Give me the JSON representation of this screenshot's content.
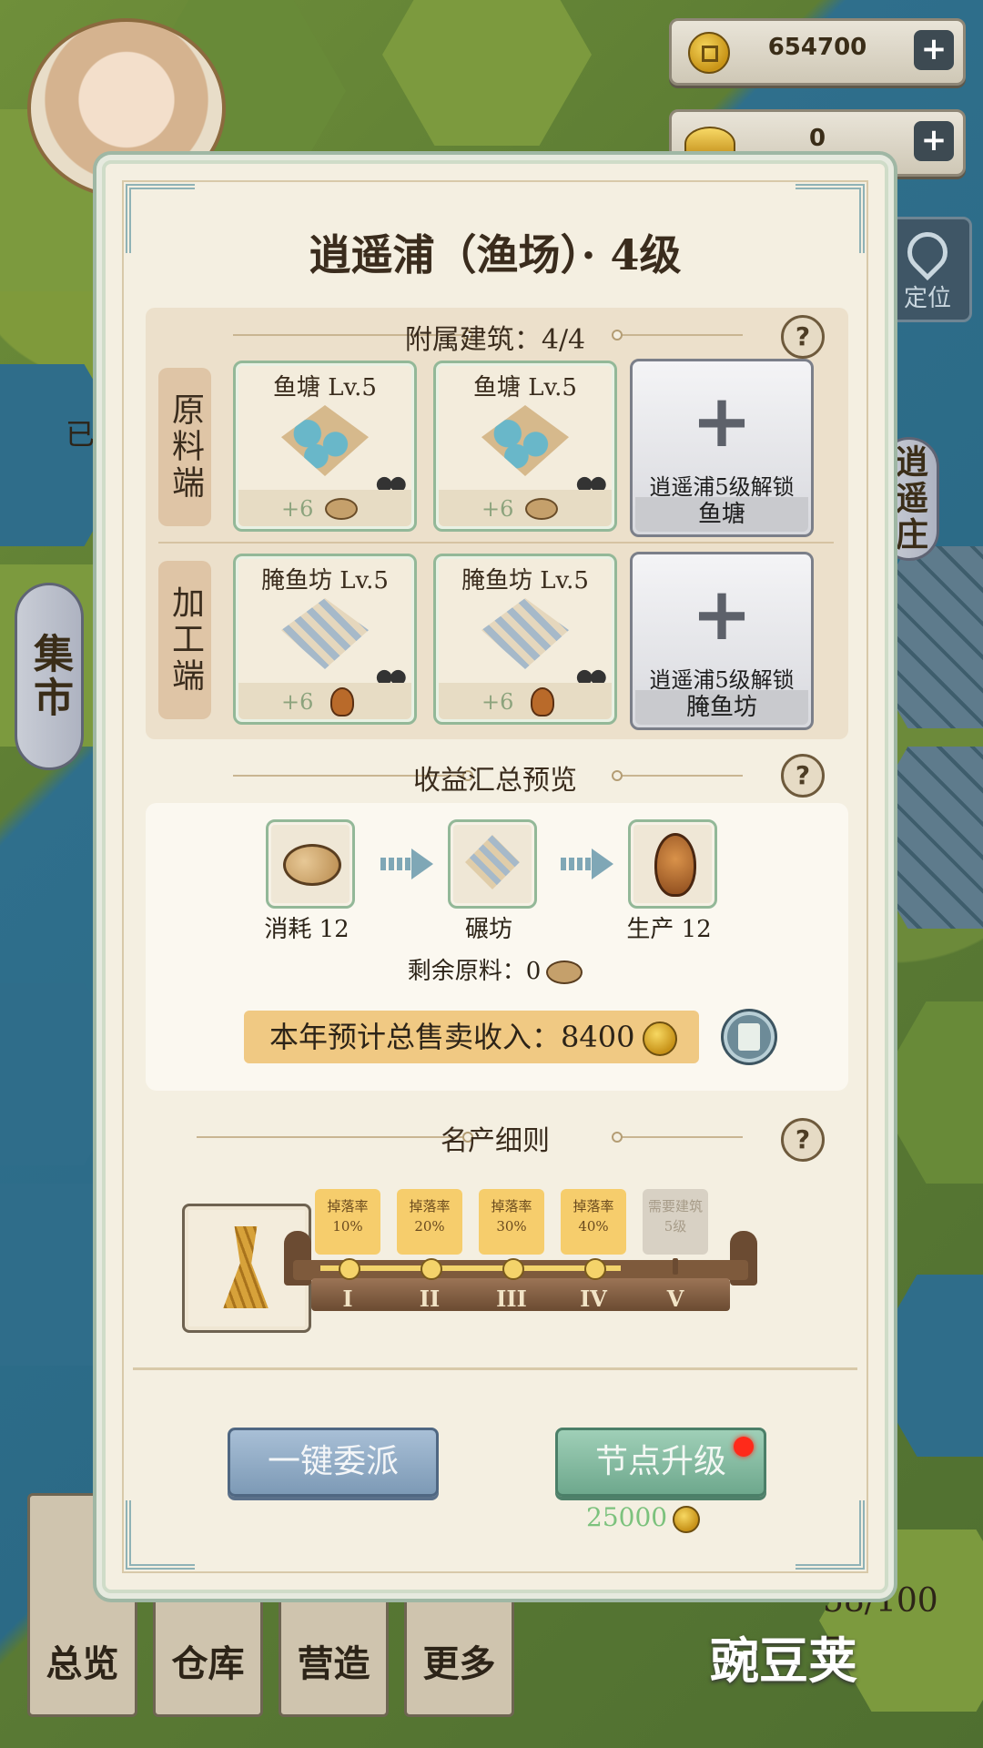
{
  "resources": {
    "copper_coins": "654700",
    "gold_ingots": "0",
    "add_label": "+"
  },
  "locate_label": "定位",
  "side_scrolls": {
    "market": "集市",
    "xiaoyaozhuang": "逍遥庄",
    "partial_left": "已"
  },
  "bottom_nav": [
    "总览",
    "仓库",
    "营造",
    "更多"
  ],
  "bottom_stats": {
    "population": "58/100",
    "partial": "7"
  },
  "modal": {
    "title": "逍遥浦（渔场）· 4级",
    "attached_header": "附属建筑：4/4",
    "rows": [
      {
        "label": "原料端",
        "buildings": [
          {
            "name": "鱼塘 Lv.5",
            "bonus": "+6"
          },
          {
            "name": "鱼塘 Lv.5",
            "bonus": "+6"
          }
        ],
        "locked": {
          "unlock_text": "逍遥浦5级解锁",
          "name": "鱼塘"
        }
      },
      {
        "label": "加工端",
        "buildings": [
          {
            "name": "腌鱼坊 Lv.5",
            "bonus": "+6"
          },
          {
            "name": "腌鱼坊 Lv.5",
            "bonus": "+6"
          }
        ],
        "locked": {
          "unlock_text": "逍遥浦5级解锁",
          "name": "腌鱼坊"
        }
      }
    ],
    "summary_header": "收益汇总预览",
    "flow": {
      "consume": "消耗 12",
      "process": "碾坊",
      "produce": "生产 12"
    },
    "remaining": "剩余原料：0",
    "income": "本年预计总售卖收入：8400",
    "specialty_header": "名产细则",
    "tiers": [
      {
        "line1": "掉落率",
        "line2": "10%",
        "roman": "I",
        "locked": false
      },
      {
        "line1": "掉落率",
        "line2": "20%",
        "roman": "II",
        "locked": false
      },
      {
        "line1": "掉落率",
        "line2": "30%",
        "roman": "III",
        "locked": false
      },
      {
        "line1": "掉落率",
        "line2": "40%",
        "roman": "IV",
        "locked": false
      },
      {
        "line1": "需要建筑",
        "line2": "5级",
        "roman": "V",
        "locked": true
      }
    ],
    "help_label": "?",
    "dispatch_button": "一键委派",
    "upgrade_button": "节点升级",
    "upgrade_cost": "25000"
  },
  "watermark": "豌豆荚",
  "colors": {
    "modal_bg": "#f4efe1",
    "card_border": "#93b898",
    "income_bg": "#f0c983",
    "upgrade_btn": "#6ea88d",
    "dispatch_btn": "#7d9ab6",
    "cost_text": "#7cc27d",
    "notify_dot": "#ff2a1a"
  }
}
